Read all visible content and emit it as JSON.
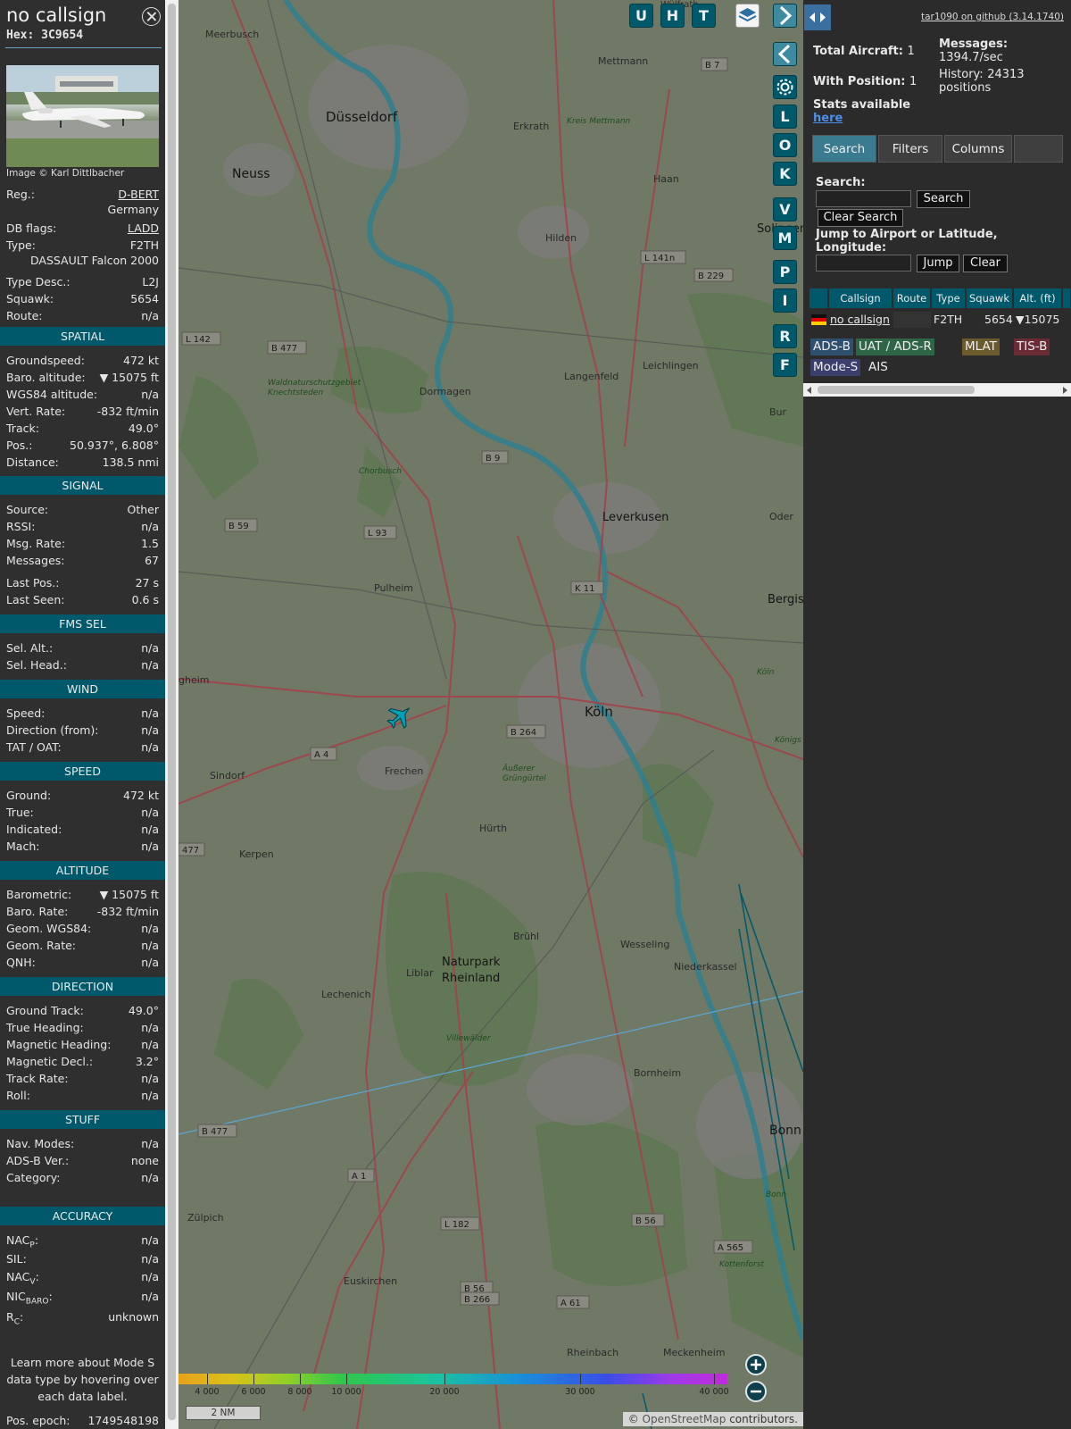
{
  "sidebar": {
    "callsign": "no callsign",
    "hex": "Hex: 3C9654",
    "photo_credit": "Image © Karl Dittlbacher",
    "top_rows": [
      {
        "k": "Reg.:",
        "v": "D-BERT",
        "link": true
      },
      {
        "k": "",
        "v": "Germany"
      },
      {
        "k": "DB flags:",
        "v": "LADD",
        "link": true
      },
      {
        "k": "Type:",
        "v": "F2TH"
      },
      {
        "k": "",
        "v": "DASSAULT Falcon 2000"
      },
      {
        "k": "Type Desc.:",
        "v": "L2J"
      },
      {
        "k": "Squawk:",
        "v": "5654"
      },
      {
        "k": "Route:",
        "v": "n/a"
      }
    ],
    "sections": {
      "spatial": {
        "title": "SPATIAL",
        "rows": [
          {
            "k": "Groundspeed:",
            "v": "472 kt"
          },
          {
            "k": "Baro. altitude:",
            "v": "▼ 15075 ft"
          },
          {
            "k": "WGS84 altitude:",
            "v": "n/a"
          },
          {
            "k": "Vert. Rate:",
            "v": "-832 ft/min"
          },
          {
            "k": "Track:",
            "v": "49.0°"
          },
          {
            "k": "Pos.:",
            "v": "50.937°, 6.808°"
          },
          {
            "k": "Distance:",
            "v": "138.5 nmi"
          }
        ]
      },
      "signal": {
        "title": "SIGNAL",
        "rows": [
          {
            "k": "Source:",
            "v": "Other"
          },
          {
            "k": "RSSI:",
            "v": "n/a"
          },
          {
            "k": "Msg. Rate:",
            "v": "1.5"
          },
          {
            "k": "Messages:",
            "v": "67"
          },
          {
            "k": "Last Pos.:",
            "v": "27 s"
          },
          {
            "k": "Last Seen:",
            "v": "0.6 s"
          }
        ]
      },
      "fms": {
        "title": "FMS SEL",
        "rows": [
          {
            "k": "Sel. Alt.:",
            "v": "n/a"
          },
          {
            "k": "Sel. Head.:",
            "v": "n/a"
          }
        ]
      },
      "wind": {
        "title": "WIND",
        "rows": [
          {
            "k": "Speed:",
            "v": "n/a"
          },
          {
            "k": "Direction (from):",
            "v": "n/a"
          },
          {
            "k": "TAT / OAT:",
            "v": "n/a"
          }
        ]
      },
      "speed": {
        "title": "SPEED",
        "rows": [
          {
            "k": "Ground:",
            "v": "472 kt"
          },
          {
            "k": "True:",
            "v": "n/a"
          },
          {
            "k": "Indicated:",
            "v": "n/a"
          },
          {
            "k": "Mach:",
            "v": "n/a"
          }
        ]
      },
      "altitude": {
        "title": "ALTITUDE",
        "rows": [
          {
            "k": "Barometric:",
            "v": "▼ 15075 ft"
          },
          {
            "k": "Baro. Rate:",
            "v": "-832 ft/min"
          },
          {
            "k": "Geom. WGS84:",
            "v": "n/a"
          },
          {
            "k": "Geom. Rate:",
            "v": "n/a"
          },
          {
            "k": "QNH:",
            "v": "n/a"
          }
        ]
      },
      "direction": {
        "title": "DIRECTION",
        "rows": [
          {
            "k": "Ground Track:",
            "v": "49.0°"
          },
          {
            "k": "True Heading:",
            "v": "n/a"
          },
          {
            "k": "Magnetic Heading:",
            "v": "n/a"
          },
          {
            "k": "Magnetic Decl.:",
            "v": "3.2°"
          },
          {
            "k": "Track Rate:",
            "v": "n/a"
          },
          {
            "k": "Roll:",
            "v": "n/a"
          }
        ]
      },
      "stuff": {
        "title": "STUFF",
        "rows": [
          {
            "k": "Nav. Modes:",
            "v": "n/a"
          },
          {
            "k": "ADS-B Ver.:",
            "v": "none"
          },
          {
            "k": "Category:",
            "v": "n/a"
          }
        ]
      },
      "accuracy": {
        "title": "ACCURACY",
        "rows": [
          {
            "k": "NAC",
            "sub": "P",
            "v": "n/a"
          },
          {
            "k": "SIL:",
            "v": "n/a"
          },
          {
            "k": "NAC",
            "sub": "V",
            "v": "n/a"
          },
          {
            "k": "NIC",
            "sub": "BARO",
            "v": "n/a"
          },
          {
            "k": "R",
            "sub": "C",
            "v": "unknown"
          }
        ]
      }
    },
    "learn_more": "Learn more about Mode S data type by hovering over each data label.",
    "pos_epoch_label": "Pos. epoch:",
    "pos_epoch_value": "1749548198"
  },
  "map": {
    "top_buttons": [
      "U",
      "H",
      "T"
    ],
    "side_buttons": [
      "L",
      "O",
      "K",
      "V",
      "M",
      "P",
      "I",
      "R",
      "F"
    ],
    "scale_label": "2 NM",
    "attribution_prefix": "© ",
    "attribution_link": "OpenStreetMap",
    "attribution_suffix": " contributors.",
    "altitude_ticks": [
      "4 000",
      "6 000",
      "8 000",
      "10 000",
      "20 000",
      "30 000",
      "40 000"
    ],
    "places": [
      {
        "name": "Meerbusch",
        "size": 11
      },
      {
        "name": "Mettmann",
        "size": 11
      },
      {
        "name": "Düsseldorf",
        "size": 15
      },
      {
        "name": "Erkrath",
        "size": 11
      },
      {
        "name": "Neuss",
        "size": 14
      },
      {
        "name": "Haan",
        "size": 11
      },
      {
        "name": "Hilden",
        "size": 11
      },
      {
        "name": "Solingen",
        "size": 13
      },
      {
        "name": "Langenfeld",
        "size": 11
      },
      {
        "name": "Leichlingen",
        "size": 11
      },
      {
        "name": "Dormagen",
        "size": 11
      },
      {
        "name": "Leverkusen",
        "size": 13
      },
      {
        "name": "Pulheim",
        "size": 11
      },
      {
        "name": "Bergisch",
        "size": 13
      },
      {
        "name": "Köln",
        "size": 15
      },
      {
        "name": "Frechen",
        "size": 11
      },
      {
        "name": "Sindorf",
        "size": 11
      },
      {
        "name": "Hürth",
        "size": 11
      },
      {
        "name": "Kerpen",
        "size": 11
      },
      {
        "name": "Brühl",
        "size": 11
      },
      {
        "name": "Wesseling",
        "size": 11
      },
      {
        "name": "Niederkassel",
        "size": 11
      },
      {
        "name": "Liblar",
        "size": 11
      },
      {
        "name": "Lechenich",
        "size": 11
      },
      {
        "name": "Bornheim",
        "size": 11
      },
      {
        "name": "Bonn",
        "size": 14
      },
      {
        "name": "Zülpich",
        "size": 11
      },
      {
        "name": "Euskirchen",
        "size": 11
      },
      {
        "name": "Rheinbach",
        "size": 11
      },
      {
        "name": "Meckenheim",
        "size": 11
      },
      {
        "name": "Naturpark",
        "size": 13
      },
      {
        "name": "Rheinland",
        "size": 13
      },
      {
        "name": "Chorbusch",
        "size": 9
      },
      {
        "name": "Villewälder",
        "size": 9
      },
      {
        "name": "Äußerer",
        "size": 9
      },
      {
        "name": "Grüngürtel",
        "size": 9
      },
      {
        "name": "Kreis Mettmann",
        "size": 9
      },
      {
        "name": "Waldnaturschutzgebiet",
        "size": 9
      },
      {
        "name": "Knechtsteden",
        "size": 9
      },
      {
        "name": "Oder",
        "size": 11
      },
      {
        "name": "Bur",
        "size": 11
      },
      {
        "name": "gheim",
        "size": 11
      },
      {
        "name": "Kottenforst",
        "size": 9
      },
      {
        "name": "Wülfrath",
        "size": 10
      },
      {
        "name": "Bonn",
        "size": 9
      },
      {
        "name": "Königs",
        "size": 9
      },
      {
        "name": "Köln",
        "size": 9
      }
    ],
    "road_labels": [
      "B 7",
      "L 141n",
      "B 229",
      "L 142",
      "B 477",
      "B 9",
      "B 59",
      "L 93",
      "K 11",
      "B 264",
      "A 4",
      "477",
      "B 477",
      "A 1",
      "L 182",
      "B 56",
      "A 565",
      "B 56",
      "B 266",
      "A 61"
    ]
  },
  "panel": {
    "github_link": "tar1090 on github (3.14.1740)",
    "total_aircraft_label": "Total Aircraft:",
    "total_aircraft_value": "1",
    "with_position_label": "With Position:",
    "with_position_value": "1",
    "messages_label": "Messages:",
    "messages_value": "1394.7/sec",
    "history_label": "History:",
    "history_value": "24313 positions",
    "stats_label": "Stats available",
    "stats_link": "here",
    "tabs": [
      "Search",
      "Filters",
      "Columns"
    ],
    "search_label": "Search:",
    "search_button": "Search",
    "clear_search_button": "Clear Search",
    "jump_label": "Jump to Airport or Latitude, Longitude:",
    "jump_button": "Jump",
    "clear_button": "Clear",
    "columns": [
      "Callsign",
      "Route",
      "Type",
      "Squawk",
      "Alt. (ft)"
    ],
    "row": {
      "callsign": "no callsign",
      "type": "F2TH",
      "squawk": "5654",
      "alt": "▼15075"
    },
    "legend": [
      {
        "label": "ADS-B",
        "color": "#2f4f6f"
      },
      {
        "label": "UAT / ADS-R",
        "color": "#2f6646"
      },
      {
        "label": "MLAT",
        "color": "#6b5a2c"
      },
      {
        "label": "TIS-B",
        "color": "#6b2b35"
      },
      {
        "label": "Mode-S",
        "color": "#3b3f6e"
      },
      {
        "label": "AIS",
        "color": "transparent"
      }
    ]
  }
}
